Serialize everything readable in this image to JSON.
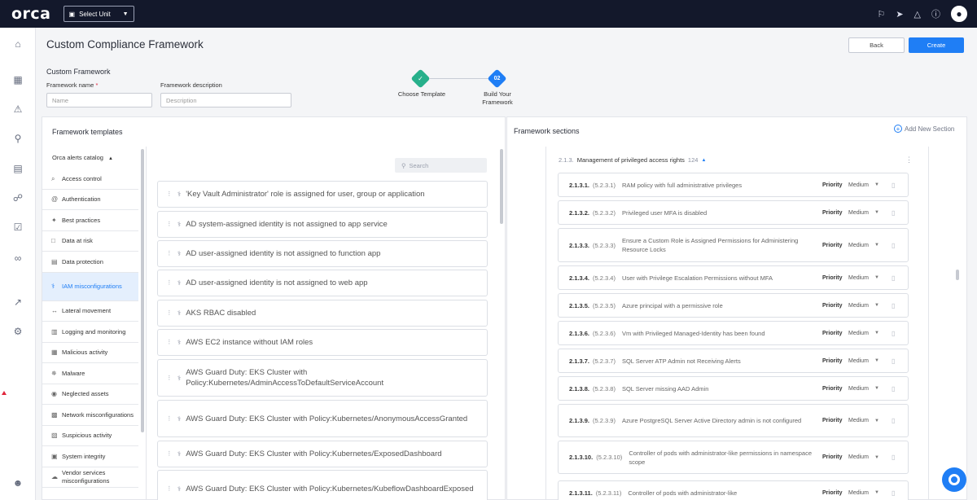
{
  "topbar": {
    "logo": "orca",
    "unit_select": "Select Unit",
    "icons": [
      "flag-icon",
      "megaphone-icon",
      "bell-icon",
      "help-icon",
      "user-avatar-icon"
    ]
  },
  "leftnav": {
    "icons": [
      "home-icon",
      "dashboard-icon",
      "alerts-icon",
      "search-icon",
      "inventory-icon",
      "graph-icon",
      "compliance-icon",
      "integrations-icon",
      "shiftleft-icon",
      "settings-icon",
      "user-icon"
    ]
  },
  "header": {
    "title": "Custom Compliance Framework",
    "back_label": "Back",
    "create_label": "Create"
  },
  "form": {
    "section_label": "Custom Framework",
    "name_label": "Framework name",
    "name_required": "*",
    "name_placeholder": "Name",
    "desc_label": "Framework description",
    "desc_placeholder": "Description"
  },
  "stepper": {
    "step1_label": "Choose Template",
    "step2_number": "02",
    "step2_label_line1": "Build Your",
    "step2_label_line2": "Framework"
  },
  "templates_panel": {
    "title": "Framework templates",
    "catalog_label": "Orca alerts catalog",
    "search_placeholder": "Search",
    "categories": [
      {
        "label": "Access control",
        "icon": "search-icon"
      },
      {
        "label": "Authentication",
        "icon": "at-icon"
      },
      {
        "label": "Best practices",
        "icon": "badge-icon"
      },
      {
        "label": "Data at risk",
        "icon": "document-icon"
      },
      {
        "label": "Data protection",
        "icon": "data-protection-icon"
      },
      {
        "label": "IAM misconfigurations",
        "icon": "iam-icon",
        "active": true
      },
      {
        "label": "Lateral movement",
        "icon": "lateral-icon"
      },
      {
        "label": "Logging and monitoring",
        "icon": "logging-icon"
      },
      {
        "label": "Malicious activity",
        "icon": "malicious-icon"
      },
      {
        "label": "Malware",
        "icon": "malware-icon"
      },
      {
        "label": "Neglected assets",
        "icon": "eye-icon"
      },
      {
        "label": "Network misconfigurations",
        "icon": "network-icon"
      },
      {
        "label": "Suspicious activity",
        "icon": "suspicious-icon"
      },
      {
        "label": "System integrity",
        "icon": "system-icon"
      },
      {
        "label": "Vendor services misconfigurations",
        "icon": "vendor-icon"
      }
    ],
    "templates": [
      "'Key Vault Administrator' role is assigned for user, group or application",
      "AD system-assigned identity is not assigned to app service",
      "AD user-assigned identity is not assigned to function app",
      "AD user-assigned identity is not assigned to web app",
      "AKS RBAC disabled",
      "AWS EC2 instance without IAM roles",
      "AWS Guard Duty: EKS Cluster with Policy:Kubernetes/AdminAccessToDefaultServiceAccount",
      "AWS Guard Duty: EKS Cluster with Policy:Kubernetes/AnonymousAccessGranted",
      "AWS Guard Duty: EKS Cluster with Policy:Kubernetes/ExposedDashboard",
      "AWS Guard Duty: EKS Cluster with Policy:Kubernetes/KubeflowDashboardExposed"
    ]
  },
  "sections_panel": {
    "title": "Framework sections",
    "add_label": "Add New Section",
    "section": {
      "number": "2.1.3.",
      "title": "Management of privileged access rights",
      "count": "124"
    },
    "priority_label": "Priority",
    "rules": [
      {
        "num": "2.1.3.1.",
        "ref": "(5.2.3.1)",
        "text": "RAM policy with full administrative privileges",
        "priority": "Medium"
      },
      {
        "num": "2.1.3.2.",
        "ref": "(5.2.3.2)",
        "text": "Privileged user MFA is disabled",
        "priority": "Medium"
      },
      {
        "num": "2.1.3.3.",
        "ref": "(5.2.3.3)",
        "text": "Ensure a Custom Role is Assigned Permissions for Administering Resource Locks",
        "priority": "Medium"
      },
      {
        "num": "2.1.3.4.",
        "ref": "(5.2.3.4)",
        "text": "User with Privilege Escalation Permissions without MFA",
        "priority": "Medium"
      },
      {
        "num": "2.1.3.5.",
        "ref": "(5.2.3.5)",
        "text": "Azure principal with a permissive role",
        "priority": "Medium"
      },
      {
        "num": "2.1.3.6.",
        "ref": "(5.2.3.6)",
        "text": "Vm with Privileged Managed-Identity has been found",
        "priority": "Medium"
      },
      {
        "num": "2.1.3.7.",
        "ref": "(5.2.3.7)",
        "text": "SQL Server ATP Admin not Receiving Alerts",
        "priority": "Medium"
      },
      {
        "num": "2.1.3.8.",
        "ref": "(5.2.3.8)",
        "text": "SQL Server missing AAD Admin",
        "priority": "Medium"
      },
      {
        "num": "2.1.3.9.",
        "ref": "(5.2.3.9)",
        "text": "Azure PostgreSQL Server Active Directory admin is not configured",
        "priority": "Medium"
      },
      {
        "num": "2.1.3.10.",
        "ref": "(5.2.3.10)",
        "text": "Controller of pods with administrator-like permissions in namespace scope",
        "priority": "Medium"
      },
      {
        "num": "2.1.3.11.",
        "ref": "(5.2.3.11)",
        "text": "Controller of pods with administrator-like",
        "priority": "Medium"
      }
    ]
  },
  "colors": {
    "topbar": "#13182b",
    "primary": "#1f7ef5",
    "step_done": "#27b08b",
    "active_bg": "#e4effd"
  }
}
